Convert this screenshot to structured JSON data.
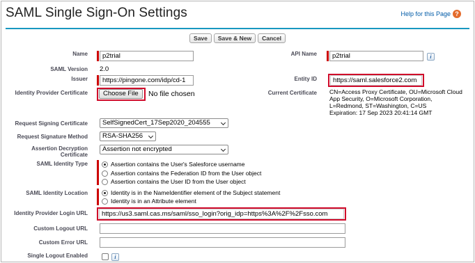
{
  "page": {
    "title": "SAML Single Sign-On Settings",
    "help_link": "Help for this Page",
    "help_icon": "help-icon"
  },
  "buttons": {
    "save": "Save",
    "save_new": "Save & New",
    "cancel": "Cancel"
  },
  "fields": {
    "name": {
      "label": "Name",
      "value": "p2trial"
    },
    "api_name": {
      "label": "API Name",
      "value": "p2trial"
    },
    "saml_version": {
      "label": "SAML Version",
      "value": "2.0"
    },
    "issuer": {
      "label": "Issuer",
      "value": "https://pingone.com/idp/cd-1"
    },
    "entity_id": {
      "label": "Entity ID",
      "value": "https://saml.salesforce2.com"
    },
    "idp_cert": {
      "label": "Identity Provider Certificate",
      "button": "Choose File",
      "status": "No file chosen"
    },
    "current_cert": {
      "label": "Current Certificate",
      "lines": [
        "CN=Access Proxy Certificate, OU=Microsoft Cloud",
        "App Security, O=Microsoft Corporation,",
        "L=Redmond, ST=Washington, C=US",
        "Expiration: 17 Sep 2023 20:41:14 GMT"
      ]
    },
    "request_signing_cert": {
      "label": "Request Signing Certificate",
      "value": "SelfSignedCert_17Sep2020_204555"
    },
    "request_sig_method": {
      "label": "Request Signature Method",
      "value": "RSA-SHA256"
    },
    "assertion_decryption": {
      "label_line1": "Assertion Decryption",
      "label_line2": "Certificate",
      "value": "Assertion not encrypted"
    },
    "saml_identity_type": {
      "label": "SAML Identity Type",
      "options": [
        "Assertion contains the User's Salesforce username",
        "Assertion contains the Federation ID from the User object",
        "Assertion contains the User ID from the User object"
      ],
      "selected": 0
    },
    "saml_identity_location": {
      "label": "SAML Identity Location",
      "options": [
        "Identity is in the NameIdentifier element of the Subject statement",
        "Identity is in an Attribute element"
      ],
      "selected": 0
    },
    "idp_login_url": {
      "label": "Identity Provider Login URL",
      "value": "https://us3.saml.cas.ms/saml/sso_login?orig_idp=https%3A%2F%2Fsso.com"
    },
    "custom_logout_url": {
      "label": "Custom Logout URL",
      "value": ""
    },
    "custom_error_url": {
      "label": "Custom Error URL",
      "value": ""
    },
    "single_logout": {
      "label": "Single Logout Enabled",
      "checked": false
    }
  },
  "colors": {
    "accent": "#1797c0",
    "required": "#cc0000",
    "highlight": "#d00a2a",
    "link": "#015ba7"
  }
}
